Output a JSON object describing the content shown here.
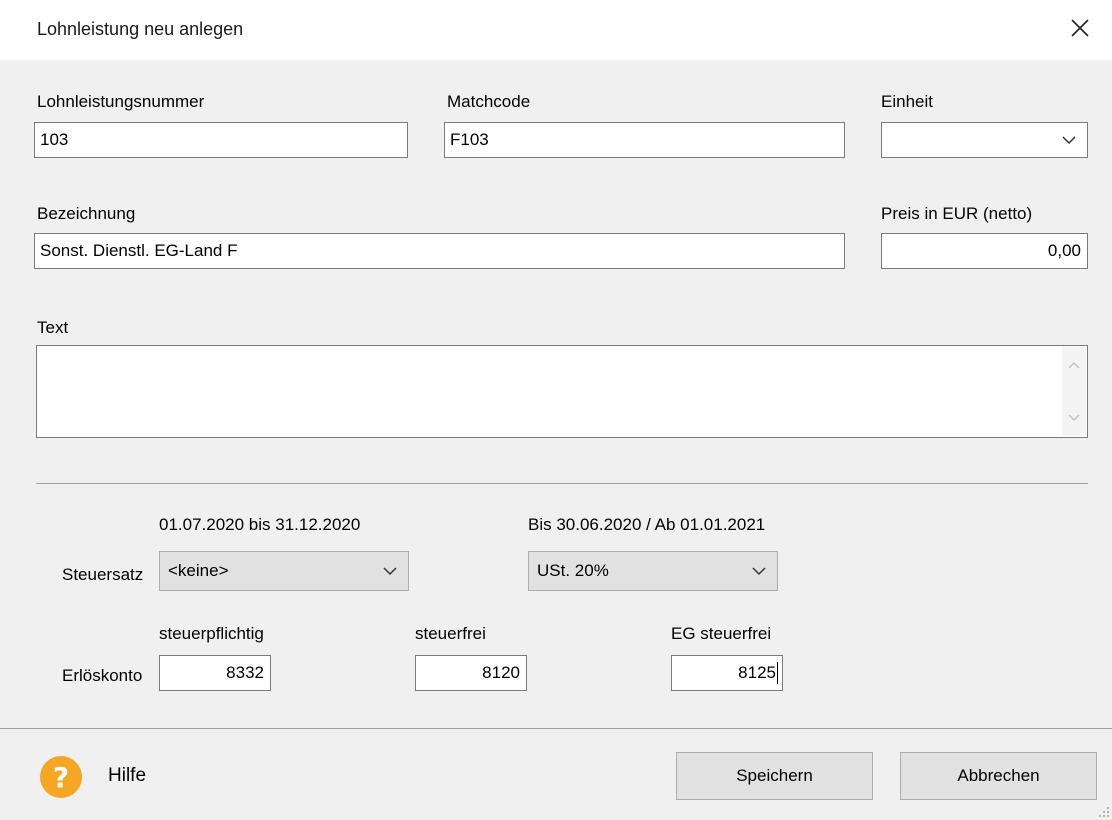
{
  "window": {
    "title": "Lohnleistung neu anlegen"
  },
  "fields": {
    "lohnleistungsnummer": {
      "label": "Lohnleistungsnummer",
      "value": "103"
    },
    "matchcode": {
      "label": "Matchcode",
      "value": "F103"
    },
    "einheit": {
      "label": "Einheit",
      "value": ""
    },
    "bezeichnung": {
      "label": "Bezeichnung",
      "value": "Sonst. Dienstl. EG-Land F"
    },
    "preis": {
      "label": "Preis in EUR (netto)",
      "value": "0,00"
    },
    "text": {
      "label": "Text",
      "value": ""
    }
  },
  "steuer": {
    "label": "Steuersatz",
    "period1_label": "01.07.2020 bis 31.12.2020",
    "period1_value": "<keine>",
    "period2_label": "Bis 30.06.2020 / Ab 01.01.2021",
    "period2_value": "USt. 20%"
  },
  "erloes": {
    "label": "Erlöskonto",
    "steuerpflichtig_label": "steuerpflichtig",
    "steuerpflichtig_value": "8332",
    "steuerfrei_label": "steuerfrei",
    "steuerfrei_value": "8120",
    "eg_label": "EG steuerfrei",
    "eg_value": "8125"
  },
  "footer": {
    "help_symbol": "?",
    "help_label": "Hilfe",
    "save_label": "Speichern",
    "cancel_label": "Abbrechen"
  },
  "icons": {
    "close": "close-icon",
    "chevron": "chevron-down-icon",
    "help": "help-icon"
  },
  "colors": {
    "help_icon": "#f5a623",
    "dialog_bg": "#f0f0f0",
    "titlebar_bg": "#ffffff"
  }
}
